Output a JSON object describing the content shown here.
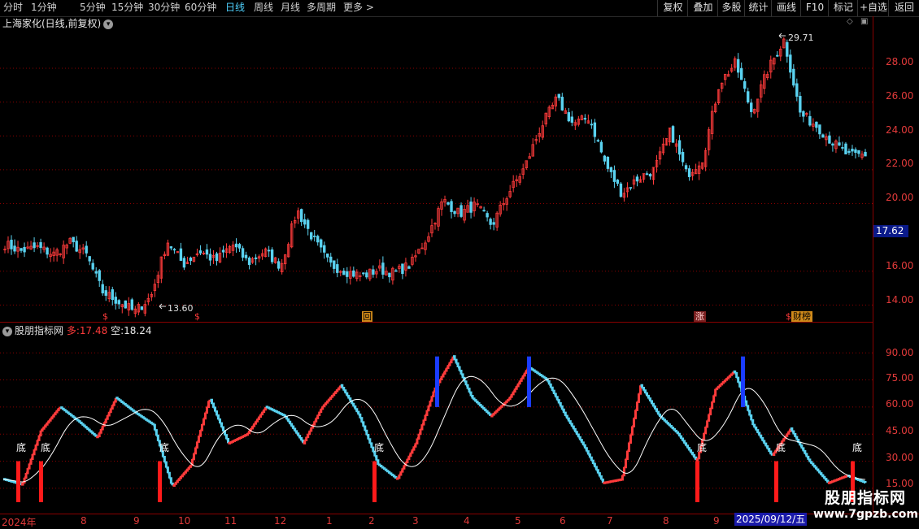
{
  "toolbar": {
    "periods": [
      "分时",
      "1分钟",
      "5分钟",
      "15分钟",
      "30分钟",
      "60分钟",
      "日线",
      "周线",
      "月线",
      "多周期",
      "更多 >"
    ],
    "active_period": "日线",
    "right_buttons": [
      "复权",
      "叠加",
      "多股",
      "统计",
      "画线",
      "F10",
      "标记",
      "+自选",
      "返回"
    ]
  },
  "stock": {
    "title": "上海家化(日线,前复权)",
    "high_label": "29.71",
    "low_label": "13.60",
    "current_price": "17.62"
  },
  "price_axis": [
    "28.00",
    "26.00",
    "24.00",
    "22.00",
    "20.00",
    "16.00",
    "14.00"
  ],
  "indicator": {
    "name": "股朋指标网",
    "long_label": "多:",
    "long_value": "17.48",
    "short_label": "空:",
    "short_value": "18.24",
    "axis": [
      "90.00",
      "75.00",
      "60.00",
      "45.00",
      "30.00",
      "15.00"
    ],
    "bottom_label": "底"
  },
  "markers": {
    "s_symbol": "$",
    "box_label": "回",
    "zhang_label": "涨",
    "cai_label": "财榜"
  },
  "date_axis": [
    "2024年",
    "8",
    "9",
    "10",
    "11",
    "12",
    "1",
    "2",
    "3",
    "4",
    "5",
    "6",
    "7",
    "8",
    "9"
  ],
  "date_cursor": "2025/09/12/五",
  "watermark": {
    "name": "股朋指标网",
    "url": "www.7gpzb.com"
  },
  "colors": {
    "up": "#ff3b3b",
    "down": "#5ad2f0",
    "ma": "#ffffff",
    "grid": "#8a0000",
    "blue_bar": "#1a3cff"
  },
  "chart_data": {
    "type": "line",
    "price_range": [
      13.6,
      29.71
    ],
    "indicator_range": [
      15,
      90
    ],
    "close_waypoints": [
      17.6,
      17.2,
      17.4,
      17.0,
      17.7,
      17.0,
      14.8,
      14.2,
      13.6,
      14.5,
      17.8,
      16.4,
      17.2,
      16.6,
      17.6,
      16.5,
      17.2,
      16.3,
      19.6,
      17.9,
      16.4,
      16.0,
      15.7,
      16.1,
      15.9,
      16.4,
      18.0,
      20.2,
      19.4,
      19.9,
      18.7,
      20.6,
      22.1,
      24.5,
      26.2,
      24.7,
      25.1,
      22.3,
      20.6,
      21.5,
      22.0,
      24.3,
      21.7,
      22.7,
      27.1,
      28.3,
      25.4,
      27.9,
      29.7,
      25.3,
      24.6,
      23.6,
      22.8,
      22.9
    ],
    "indicator_waypoints": [
      20,
      17,
      47,
      60,
      52,
      43,
      65,
      57,
      50,
      16,
      28,
      65,
      40,
      45,
      60,
      55,
      40,
      60,
      72,
      55,
      28,
      20,
      40,
      70,
      88,
      65,
      55,
      65,
      82,
      75,
      55,
      38,
      18,
      20,
      72,
      55,
      45,
      30,
      70,
      80,
      50,
      33,
      48,
      30,
      18,
      22,
      18
    ]
  }
}
